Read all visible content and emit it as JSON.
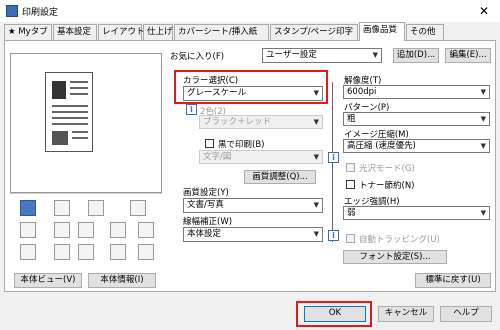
{
  "window": {
    "title": "印刷設定",
    "close_icon": "✕"
  },
  "tabs": [
    "Myタブ",
    "基本設定",
    "レイアウト",
    "仕上げ",
    "カバーシート/挿入紙",
    "スタンプ/ページ印字",
    "画像品質",
    "その他"
  ],
  "favorites": {
    "label": "お気に入り(F)",
    "value": "ユーザー設定",
    "add_label": "追加(D)...",
    "edit_label": "編集(E)..."
  },
  "color": {
    "label": "カラー選択(C)",
    "value": "グレースケール",
    "two_color_label": "2色(2)",
    "two_color_value": "ブラック＋レッド",
    "black_print_label": "黒で印刷(B)",
    "black_print_value": "文字/図",
    "adjust_label": "画質調整(Q)..."
  },
  "quality": {
    "label": "画質設定(Y)",
    "value": "文書/写真"
  },
  "line": {
    "label": "線幅補正(W)",
    "value": "本体設定"
  },
  "resolution": {
    "label": "解像度(T)",
    "value": "600dpi"
  },
  "pattern": {
    "label": "パターン(P)",
    "value": "粗"
  },
  "compression": {
    "label": "イメージ圧縮(M)",
    "value": "高圧縮 (速度優先)"
  },
  "gloss": {
    "label": "光沢モード(G)"
  },
  "toner": {
    "label": "トナー節約(N)"
  },
  "edge": {
    "label": "エッジ強調(H)",
    "value": "弱"
  },
  "trapping": {
    "label": "自動トラッピング(U)"
  },
  "font_settings_label": "フォント設定(S)...",
  "defaults_label": "標準に戻す(U)",
  "preview_buttons": {
    "device_view": "本体ビュー(V)",
    "device_info": "本体情報(I)"
  },
  "footer": {
    "ok": "OK",
    "cancel": "キャンセル",
    "help": "ヘルプ"
  }
}
